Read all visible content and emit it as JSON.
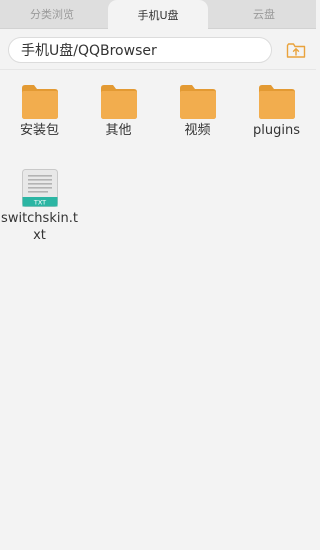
{
  "tabs": [
    {
      "label": "分类浏览"
    },
    {
      "label": "手机U盘"
    },
    {
      "label": "云盘"
    }
  ],
  "path": {
    "value": "手机U盘/QQBrowser"
  },
  "items": [
    {
      "label": "安装包",
      "type": "folder"
    },
    {
      "label": "其他",
      "type": "folder"
    },
    {
      "label": "视频",
      "type": "folder"
    },
    {
      "label": "plugins",
      "type": "folder"
    },
    {
      "label": "switchskin.txt",
      "type": "file",
      "badge": "TXT"
    }
  ],
  "colors": {
    "folder": "#f2ad4e",
    "folder_dark": "#e39a33",
    "accent": "#e9a23b",
    "txt_badge": "#2bb5a3"
  },
  "icons": {
    "up_button": "folder-up-icon",
    "folder": "folder-icon",
    "file": "txt-file-icon"
  }
}
